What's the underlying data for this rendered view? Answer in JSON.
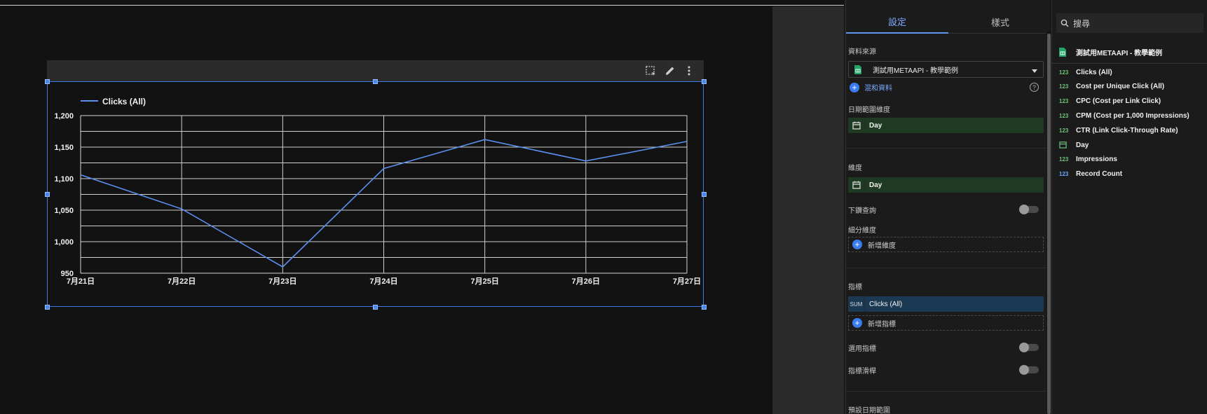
{
  "setup_panel": {
    "tabs": [
      {
        "label": "設定",
        "active": true
      },
      {
        "label": "樣式",
        "active": false
      }
    ],
    "data_source_label": "資料來源",
    "data_source_name": "測試用METAAPI - 教學範例",
    "blend_data_label": "混和資料",
    "date_range_dimension_label": "日期範圍維度",
    "date_range_dimension_value": "Day",
    "dimension_label": "維度",
    "dimension_value": "Day",
    "drill_down_label": "下鑽查詢",
    "breakdown_label": "細分維度",
    "add_dimension_label": "新增維度",
    "metric_label": "指標",
    "metric_agg": "SUM",
    "metric_value": "Clicks (All)",
    "add_metric_label": "新增指標",
    "optional_metrics_label": "選用指標",
    "metric_slider_label": "指標滑桿",
    "default_date_range_label": "預設日期範圍"
  },
  "fields_panel": {
    "search_placeholder": "搜尋",
    "source_name": "測試用METAAPI - 教學範例",
    "fields": [
      {
        "type": "123",
        "name": "Clicks (All)"
      },
      {
        "type": "123",
        "name": "Cost per Unique Click (All)"
      },
      {
        "type": "123",
        "name": "CPC (Cost per Link Click)"
      },
      {
        "type": "123",
        "name": "CPM (Cost per 1,000 Impressions)"
      },
      {
        "type": "123",
        "name": "CTR (Link Click-Through Rate)"
      },
      {
        "type": "calendar",
        "name": "Day"
      },
      {
        "type": "123",
        "name": "Impressions"
      },
      {
        "type": "123",
        "name": "Record Count"
      }
    ]
  },
  "colors": {
    "accent": "#4a86f0",
    "series": "#5b8ff0",
    "dimension_bg": "#1e3a22",
    "metric_bg": "#1c3954"
  },
  "chart_data": {
    "type": "line",
    "categories": [
      "7月21日",
      "7月22日",
      "7月23日",
      "7月24日",
      "7月25日",
      "7月26日",
      "7月27日"
    ],
    "series": [
      {
        "name": "Clicks (All)",
        "values": [
          1106,
          1052,
          960,
          1116,
          1162,
          1128,
          1159
        ]
      }
    ],
    "ylim": [
      950,
      1200
    ],
    "yticks": [
      "950",
      "1,000",
      "1,050",
      "1,100",
      "1,150",
      "1,200"
    ],
    "grid": true,
    "legend": "top-left"
  }
}
